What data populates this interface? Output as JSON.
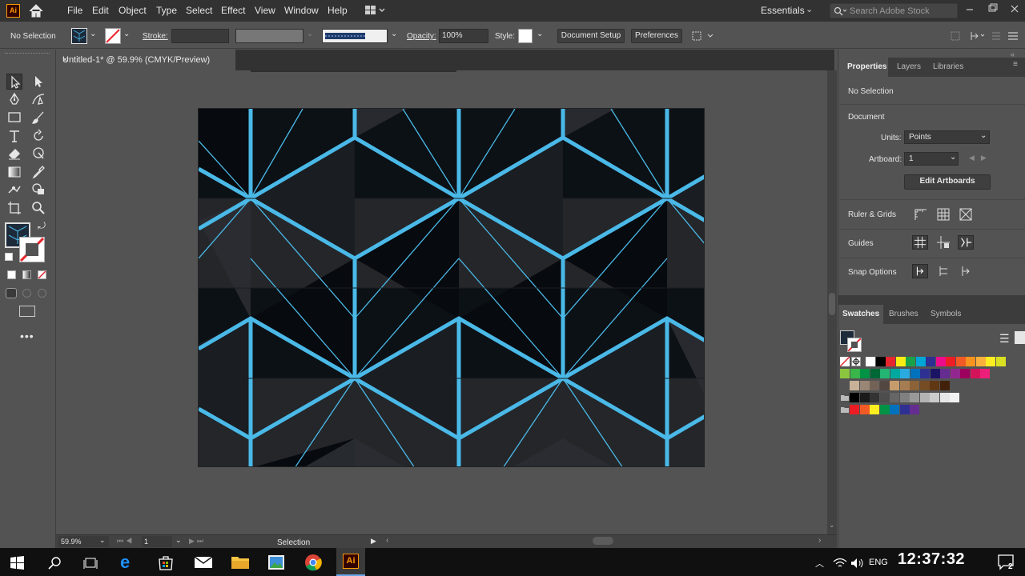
{
  "app": {
    "logo": "Ai"
  },
  "menu": [
    "File",
    "Edit",
    "Object",
    "Type",
    "Select",
    "Effect",
    "View",
    "Window",
    "Help"
  ],
  "workspace": {
    "name": "Essentials",
    "search_placeholder": "Search Adobe Stock"
  },
  "control": {
    "selection": "No Selection",
    "stroke_label": "Stroke:",
    "opacity_label": "Opacity:",
    "opacity_value": "100%",
    "style_label": "Style:",
    "doc_setup": "Document Setup",
    "preferences": "Preferences"
  },
  "document_tab": {
    "title": "Untitled-1* @ 59.9% (CMYK/Preview)",
    "close": "×"
  },
  "status": {
    "zoom": "59.9%",
    "page": "1",
    "tool": "Selection"
  },
  "properties": {
    "tabs": [
      "Properties",
      "Layers",
      "Libraries"
    ],
    "selection": "No Selection",
    "document_heading": "Document",
    "units_label": "Units:",
    "units_value": "Points",
    "artboard_label": "Artboard:",
    "artboard_value": "1",
    "edit_artboards": "Edit Artboards",
    "rulers_grids": "Ruler & Grids",
    "guides": "Guides",
    "snap_options": "Snap Options"
  },
  "swatches": {
    "tabs": [
      "Swatches",
      "Brushes",
      "Symbols"
    ],
    "row1": [
      "#ffffff",
      "#000000",
      "#e8262e",
      "#f7ec13",
      "#1aa24b",
      "#00a7d6",
      "#2e3092",
      "#ec0c8c",
      "#ee1c25",
      "#f15a24",
      "#f7931e",
      "#fbb03b",
      "#fcee21",
      "#d9e021"
    ],
    "row2": [
      "#8cc63f",
      "#39b54a",
      "#009245",
      "#006837",
      "#22b573",
      "#00a99d",
      "#29abe2",
      "#0071bc",
      "#2e3192",
      "#1b1464",
      "#662d91",
      "#93278f",
      "#9e005d",
      "#d4145a",
      "#ed1e79"
    ],
    "row3": [
      "#c7b299",
      "#998675",
      "#736357",
      "#534741",
      "#c69c6d",
      "#a67c52",
      "#8c6239",
      "#754c24",
      "#603813",
      "#42210b"
    ],
    "row4": [
      "#000000",
      "#1a1a1a",
      "#333333",
      "#4d4d4d",
      "#666666",
      "#808080",
      "#999999",
      "#b3b3b3",
      "#cccccc",
      "#e6e6e6",
      "#f2f2f2"
    ],
    "row5": [
      "#ed1c24",
      "#f15a24",
      "#fcee21",
      "#009245",
      "#0071bc",
      "#2e3192",
      "#662d91"
    ]
  },
  "taskbar": {
    "language": "ENG",
    "time": "12:37:32",
    "notifications": "2"
  },
  "colors": {
    "accent_blue": "#4ab9e8",
    "artboard_dark": "#0b0f14"
  }
}
